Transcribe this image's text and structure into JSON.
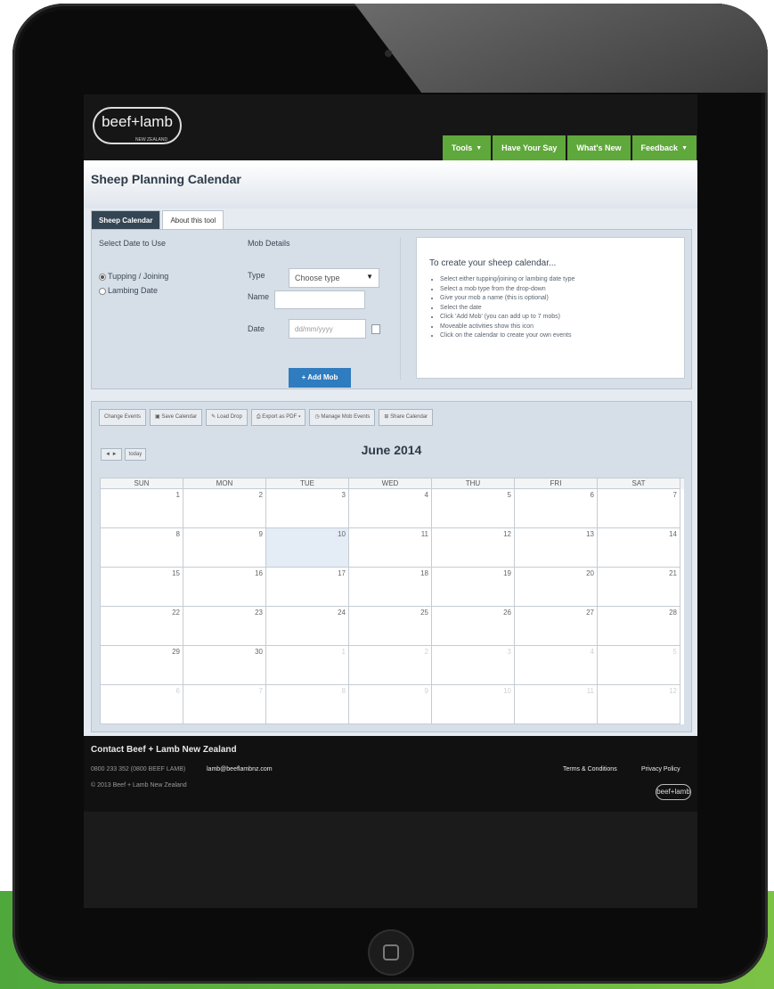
{
  "header": {
    "logo_text": "beef+lamb",
    "logo_sub": "NEW ZEALAND",
    "nav": [
      {
        "label": "Tools",
        "dropdown": true
      },
      {
        "label": "Have Your Say",
        "dropdown": false
      },
      {
        "label": "What's New",
        "dropdown": false
      },
      {
        "label": "Feedback",
        "dropdown": true
      }
    ]
  },
  "page": {
    "title": "Sheep Planning Calendar",
    "tabs": [
      "Sheep Calendar",
      "About this tool"
    ]
  },
  "form": {
    "date_heading": "Select Date to Use",
    "options": [
      "Tupping / Joining",
      "Lambing Date"
    ],
    "mob_heading": "Mob Details",
    "type_label": "Type",
    "type_value": "Choose type",
    "name_label": "Name",
    "date_label": "Date",
    "date_placeholder": "dd/mm/yyyy",
    "add_button": "+ Add Mob"
  },
  "info": {
    "title": "To create your sheep calendar...",
    "steps": [
      "Select either tupping/joining or lambing date type",
      "Select a mob type from the drop-down",
      "Give your mob a name (this is optional)",
      "Select the date",
      "Click 'Add Mob' (you can add up to 7 mobs)",
      "Moveable activities show this icon",
      "Click on the calendar to create your own events"
    ]
  },
  "calendar": {
    "toolbar": [
      "Change Events",
      "Save Calendar",
      "Load Drop",
      "Export as PDF",
      "Manage Mob Events",
      "Share Calendar"
    ],
    "nav_buttons": [
      "◄ ►",
      "today"
    ],
    "month": "June 2014",
    "days": [
      "SUN",
      "MON",
      "TUE",
      "WED",
      "THU",
      "FRI",
      "SAT"
    ],
    "weeks": [
      [
        "1",
        "2",
        "3",
        "4",
        "5",
        "6",
        "7"
      ],
      [
        "8",
        "9",
        "10",
        "11",
        "12",
        "13",
        "14"
      ],
      [
        "15",
        "16",
        "17",
        "18",
        "19",
        "20",
        "21"
      ],
      [
        "22",
        "23",
        "24",
        "25",
        "26",
        "27",
        "28"
      ],
      [
        "29",
        "30",
        "1",
        "2",
        "3",
        "4",
        "5"
      ],
      [
        "6",
        "7",
        "8",
        "9",
        "10",
        "11",
        "12"
      ]
    ],
    "today": "10"
  },
  "footer": {
    "title": "Contact Beef + Lamb New Zealand",
    "phone": "0800 233 352 (0800 BEEF LAMB)",
    "email": "lamb@beeflambnz.com",
    "copyright": "© 2013 Beef + Lamb New Zealand",
    "links": [
      "Terms & Conditions",
      "Privacy Policy"
    ],
    "logo_text": "beef+lamb"
  },
  "colors": {
    "nav_green": "#5fa83b",
    "button_blue": "#2f7cbf",
    "panel": "#d6dfe8"
  }
}
